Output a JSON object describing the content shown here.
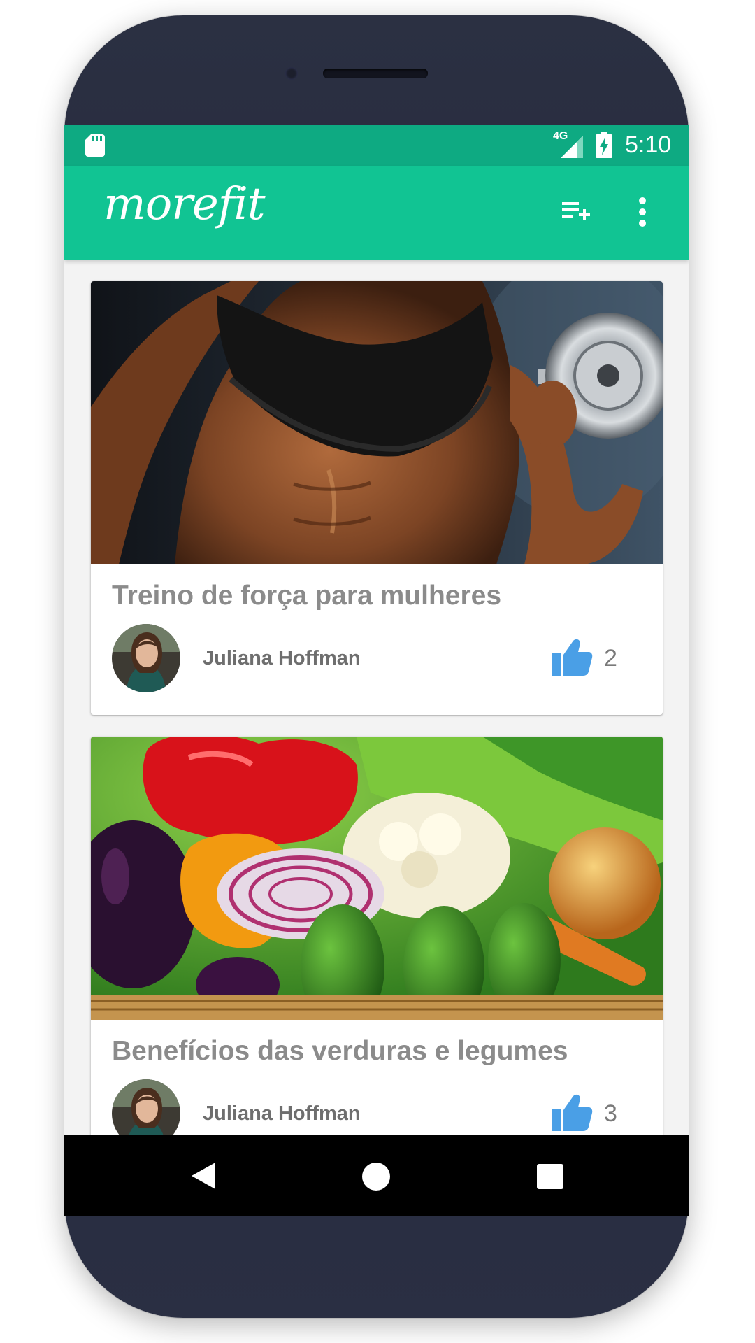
{
  "status_bar": {
    "network": "4G",
    "time": "5:10"
  },
  "app_bar": {
    "logo": "morefit",
    "actions": [
      {
        "icon": "playlist-add-icon"
      },
      {
        "icon": "more-vert-icon"
      }
    ]
  },
  "posts": [
    {
      "title": "Treino de força para mulheres",
      "author": "Juliana Hoffman",
      "likes": "2",
      "image": "fitness-woman-dumbbell"
    },
    {
      "title": "Benefícios das verduras e legumes",
      "author": "Juliana Hoffman",
      "likes": "3",
      "image": "vegetables-basket"
    }
  ],
  "nav_bar": {
    "buttons": [
      "back",
      "home",
      "recents"
    ]
  },
  "colors": {
    "status_bar": "#0eaa82",
    "app_bar": "#11c493",
    "like": "#4a9fe6",
    "title_text": "#8b8b8b"
  }
}
